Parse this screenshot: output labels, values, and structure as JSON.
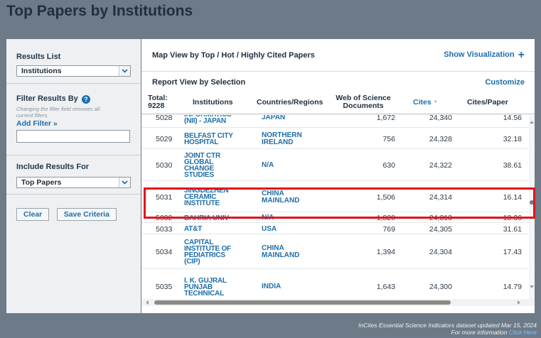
{
  "page": {
    "title": "Top Papers by Institutions"
  },
  "left_panel": {
    "results_list": {
      "heading": "Results List",
      "selected": "Institutions"
    },
    "filter": {
      "heading": "Filter Results By",
      "help": "?",
      "note_line1": "Changing the filter field removes all",
      "note_line2": "current filters.",
      "add_filter": "Add Filter »",
      "input_value": ""
    },
    "include": {
      "heading": "Include Results For",
      "selected": "Top Papers"
    },
    "buttons": {
      "clear": "Clear",
      "save": "Save Criteria"
    }
  },
  "main": {
    "map_bar": {
      "label": "Map View by Top / Hot / Highly Cited Papers",
      "action": "Show Visualization",
      "action_icon": "+"
    },
    "report_bar": {
      "label": "Report View by Selection",
      "action": "Customize"
    },
    "table": {
      "total_label": "Total:",
      "total_value": "9228",
      "columns": {
        "institutions": "Institutions",
        "countries": "Countries/Regions",
        "docs_line1": "Web of Science",
        "docs_line2": "Documents",
        "cites": "Cites",
        "cites_per_paper": "Cites/Paper"
      },
      "sort_indicator": "▼",
      "rows": [
        {
          "rank": "5028",
          "institution": [
            "INFORMATICS",
            "(NII) - JAPAN"
          ],
          "country": [
            "JAPAN"
          ],
          "docs": "1,672",
          "cites": "24,340",
          "cpp": "14.56"
        },
        {
          "rank": "5029",
          "institution": [
            "BELFAST CITY",
            "HOSPITAL"
          ],
          "country": [
            "NORTHERN",
            "IRELAND"
          ],
          "docs": "756",
          "cites": "24,328",
          "cpp": "32.18"
        },
        {
          "rank": "5030",
          "institution": [
            "JOINT CTR",
            "GLOBAL",
            "CHANGE",
            "STUDIES"
          ],
          "country": [
            "N/A"
          ],
          "docs": "630",
          "cites": "24,322",
          "cpp": "38.61"
        },
        {
          "rank": "5031",
          "institution": [
            "JINGDEZHEN",
            "CERAMIC",
            "INSTITUTE"
          ],
          "country": [
            "CHINA",
            "MAINLAND"
          ],
          "docs": "1,506",
          "cites": "24,314",
          "cpp": "16.14"
        },
        {
          "rank": "5032",
          "institution": [
            "BAHRIA UNIV"
          ],
          "country": [
            "N/A"
          ],
          "docs": "1,820",
          "cites": "24,313",
          "cpp": "13.36"
        },
        {
          "rank": "5033",
          "institution": [
            "AT&T"
          ],
          "country": [
            "USA"
          ],
          "docs": "769",
          "cites": "24,305",
          "cpp": "31.61"
        },
        {
          "rank": "5034",
          "institution": [
            "CAPITAL",
            "INSTITUTE OF",
            "PEDIATRICS",
            "(CIP)"
          ],
          "country": [
            "CHINA",
            "MAINLAND"
          ],
          "docs": "1,394",
          "cites": "24,304",
          "cpp": "17.43"
        },
        {
          "rank": "5035",
          "institution": [
            "I. K. GUJRAL",
            "PUNJAB",
            "TECHNICAL"
          ],
          "country": [
            "INDIA"
          ],
          "docs": "1,643",
          "cites": "24,300",
          "cpp": "14.79"
        }
      ]
    }
  },
  "footer": {
    "line1": "InCites Essential Science Indicators dataset updated Mar 15, 2024",
    "line2_prefix": "For more information",
    "line2_link": "Click Here"
  },
  "colors": {
    "highlight": "#e2141b",
    "link": "#1d6ea8",
    "background": "#6d7a88"
  }
}
